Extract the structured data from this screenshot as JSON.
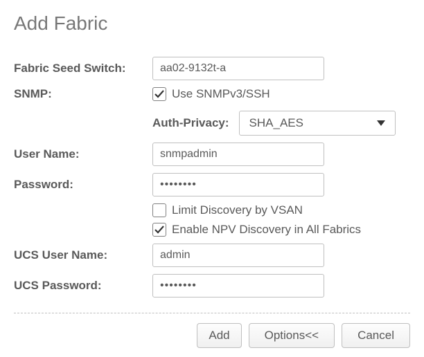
{
  "title": "Add Fabric",
  "labels": {
    "fabric_seed_switch": "Fabric Seed Switch:",
    "snmp": "SNMP:",
    "auth_privacy": "Auth-Privacy:",
    "user_name": "User Name:",
    "password": "Password:",
    "ucs_user_name": "UCS User Name:",
    "ucs_password": "UCS Password:"
  },
  "inputs": {
    "fabric_seed_switch": "aa02-9132t-a",
    "user_name": "snmpadmin",
    "password": "••••••••",
    "ucs_user_name": "admin",
    "ucs_password": "••••••••"
  },
  "checkboxes": {
    "use_snmp": {
      "label": "Use SNMPv3/SSH",
      "checked": true
    },
    "limit_discovery": {
      "label": "Limit Discovery by VSAN",
      "checked": false
    },
    "enable_npv": {
      "label": "Enable NPV Discovery in All Fabrics",
      "checked": true
    }
  },
  "select": {
    "auth_privacy_value": "SHA_AES"
  },
  "buttons": {
    "add": "Add",
    "options": "Options<<",
    "cancel": "Cancel"
  }
}
